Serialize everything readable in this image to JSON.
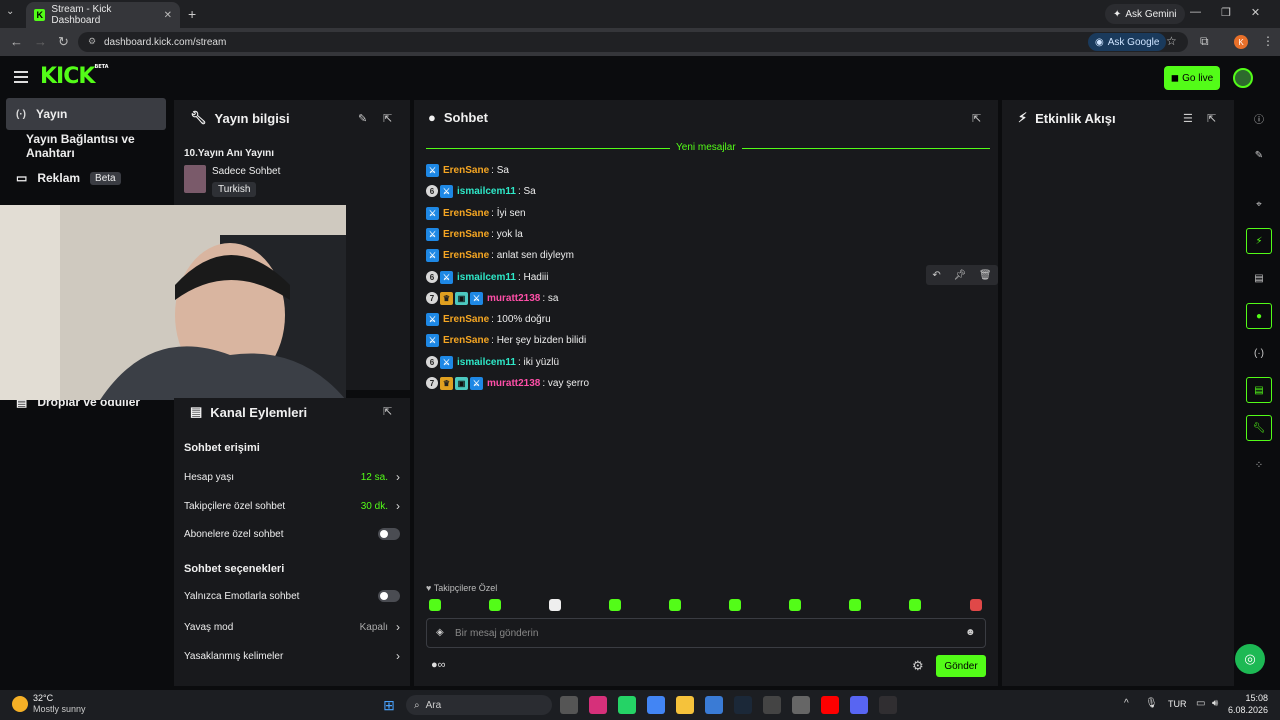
{
  "browser": {
    "tab_title": "Stream - Kick Dashboard",
    "url": "dashboard.kick.com/stream",
    "ask_gemini": "Ask Gemini",
    "ask_google": "Ask Google",
    "profile_initial": "K"
  },
  "header": {
    "logo": "KICK",
    "logo_badge": "BETA",
    "go_live": "Go live"
  },
  "sidebar": {
    "items": [
      {
        "label": "Yayın"
      },
      {
        "label": "Yayın Bağlantısı ve Anahtarı"
      },
      {
        "label": "Reklam",
        "badge": "Beta"
      },
      {
        "label": "Droplar ve ödüller"
      }
    ]
  },
  "stream_info": {
    "title": "Yayın bilgisi",
    "stream_title": "10.Yayın Anı Yayını",
    "category": "Sadece Sohbet",
    "language": "Turkish"
  },
  "channel_actions": {
    "title": "Kanal Eylemleri",
    "chat_access_heading": "Sohbet erişimi",
    "account_age_label": "Hesap yaşı",
    "account_age_value": "12 sa.",
    "followers_label": "Takipçilere özel sohbet",
    "followers_value": "30 dk.",
    "subscribers_label": "Abonelere özel sohbet",
    "chat_options_heading": "Sohbet seçenekleri",
    "emote_only_label": "Yalnızca Emotlarla sohbet",
    "slow_mode_label": "Yavaş mod",
    "slow_mode_value": "Kapalı",
    "banned_words_label": "Yasaklanmış kelimeler"
  },
  "chat": {
    "title": "Sohbet",
    "new_messages": "Yeni mesajlar",
    "messages": [
      {
        "user": "ErenSane",
        "text": ": Sa",
        "color": "#f5a623",
        "badges": [
          "mod"
        ]
      },
      {
        "user": "ismailcem11",
        "text": ": Sa",
        "color": "#2ee8c8",
        "badges": [
          "6",
          "mod"
        ]
      },
      {
        "user": "ErenSane",
        "text": ": İyi sen",
        "color": "#f5a623",
        "badges": [
          "mod"
        ]
      },
      {
        "user": "ErenSane",
        "text": ": yok la",
        "color": "#f5a623",
        "badges": [
          "mod"
        ]
      },
      {
        "user": "ErenSane",
        "text": ": anlat sen diyleym",
        "color": "#f5a623",
        "badges": [
          "mod"
        ]
      },
      {
        "user": "ismailcem11",
        "text": ": Hadiii",
        "color": "#2ee8c8",
        "badges": [
          "6",
          "mod"
        ]
      },
      {
        "user": "muratt2138",
        "text": ": sa",
        "color": "#ff4fa8",
        "badges": [
          "7",
          "crown",
          "sub",
          "mod"
        ]
      },
      {
        "user": "ErenSane",
        "text": ": 100% doğru",
        "color": "#f5a623",
        "badges": [
          "mod"
        ]
      },
      {
        "user": "ErenSane",
        "text": ": Her şey bizden bilidi",
        "color": "#f5a623",
        "badges": [
          "mod"
        ]
      },
      {
        "user": "ismailcem11",
        "text": ": iki yüzlü",
        "color": "#2ee8c8",
        "badges": [
          "6",
          "mod"
        ]
      },
      {
        "user": "muratt2138",
        "text": ": vay şerro",
        "color": "#ff4fa8",
        "badges": [
          "7",
          "crown",
          "sub",
          "mod"
        ]
      }
    ],
    "followers_only": "Takipçilere Özel",
    "input_placeholder": "Bir mesaj gönderin",
    "send": "Gönder"
  },
  "activity": {
    "title": "Etkinlik Akışı"
  },
  "taskbar": {
    "weather_temp": "32°C",
    "weather_desc": "Mostly sunny",
    "search": "Ara",
    "lang": "TUR",
    "time": "15:08",
    "date": "6.08.2026"
  },
  "colors": {
    "accent": "#53fc18",
    "panel": "#18191c",
    "background": "#0b0c0e"
  }
}
